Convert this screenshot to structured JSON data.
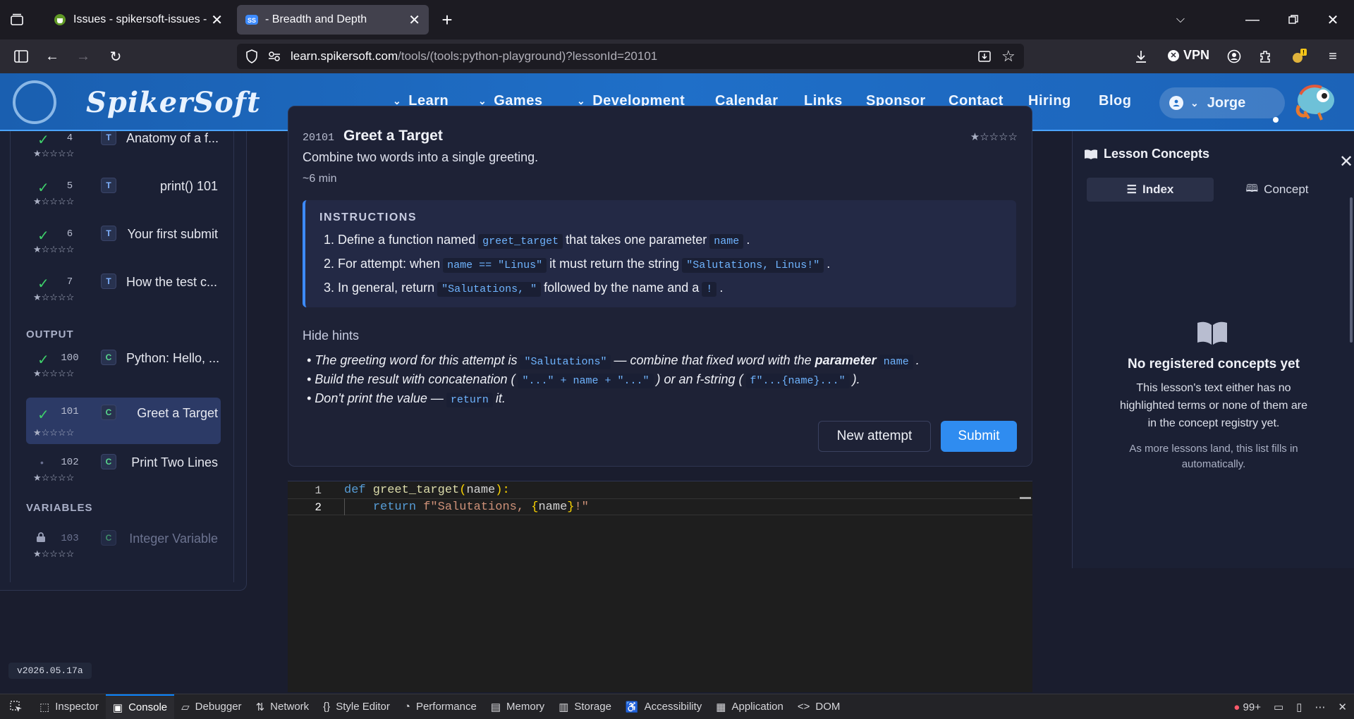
{
  "browser": {
    "tabs": [
      {
        "title": "Issues - spikersoft-issues - Gitea",
        "active": false
      },
      {
        "title": "- Breadth and Depth",
        "active": true
      }
    ],
    "url_domain": "learn.spikersoft.com",
    "url_path": "/tools/(tools:python-playground)?lessonId=20101",
    "vpn_label": "VPN"
  },
  "site": {
    "brand": "SpikerSoft",
    "nav": [
      {
        "label": "Learn",
        "dropdown": true
      },
      {
        "label": "Games",
        "dropdown": true
      },
      {
        "label": "Development",
        "dropdown": true
      },
      {
        "label": "Calendar",
        "dropdown": false
      },
      {
        "label": "Links",
        "dropdown": false
      },
      {
        "label": "Sponsor",
        "dropdown": false
      },
      {
        "label": "Contact",
        "dropdown": false
      },
      {
        "label": "Hiring",
        "dropdown": false
      },
      {
        "label": "Blog",
        "dropdown": false
      }
    ],
    "user": "Jorge"
  },
  "sidebar": {
    "lessons": [
      {
        "status": "done",
        "num": "4",
        "type": "T",
        "name": "Anatomy of a f...",
        "stars": "★☆☆☆☆"
      },
      {
        "status": "done",
        "num": "5",
        "type": "T",
        "name": "print() 101",
        "stars": "★☆☆☆☆"
      },
      {
        "status": "done",
        "num": "6",
        "type": "T",
        "name": "Your first submit",
        "stars": "★☆☆☆☆"
      },
      {
        "status": "done",
        "num": "7",
        "type": "T",
        "name": "How the test c...",
        "stars": "★☆☆☆☆"
      }
    ],
    "section_output": "OUTPUT",
    "output_lessons": [
      {
        "status": "done",
        "num": "100",
        "type": "C",
        "name": "Python: Hello, ...",
        "stars": "★☆☆☆☆"
      },
      {
        "status": "done",
        "num": "101",
        "type": "C",
        "name": "Greet a Target",
        "stars": "★☆☆☆☆"
      },
      {
        "status": "open",
        "num": "102",
        "type": "C",
        "name": "Print Two Lines",
        "stars": "★☆☆☆☆"
      }
    ],
    "section_variables": "VARIABLES",
    "variable_lessons": [
      {
        "status": "locked",
        "num": "103",
        "type": "C",
        "name": "Integer Variable",
        "stars": "★☆☆☆☆"
      }
    ],
    "version": "v2026.05.17a"
  },
  "lesson": {
    "id": "20101",
    "title": "Greet a Target",
    "stars": "★☆☆☆☆",
    "description": "Combine two words into a single greeting.",
    "time": "~6 min",
    "instructions_heading": "INSTRUCTIONS",
    "steps": {
      "s1a": "1. Define a function named",
      "s1code1": "greet_target",
      "s1b": "that takes one parameter",
      "s1code2": "name",
      "s1c": ".",
      "s2a": "2. For attempt: when",
      "s2code1": "name == \"Linus\"",
      "s2b": "it must return the string",
      "s2code2": "\"Salutations, Linus!\"",
      "s2c": ".",
      "s3a": "3. In general, return",
      "s3code1": "\"Salutations, \"",
      "s3b": "followed by the name and a",
      "s3code2": "!",
      "s3c": "."
    },
    "hide_hints": "Hide hints",
    "hints": {
      "h1a": "The greeting word for this attempt is",
      "h1code1": "\"Salutations\"",
      "h1b": "— combine that fixed word with the",
      "h1bold": "parameter",
      "h1code2": "name",
      "h1c": ".",
      "h2a": "Build the result with concatenation (",
      "h2code1": "\"...\" + name + \"...\"",
      "h2b": ") or an f-string (",
      "h2code2": "f\"...{name}...\"",
      "h2c": ").",
      "h3a": "Don't print the value —",
      "h3code1": "return",
      "h3b": "it."
    },
    "new_attempt": "New attempt",
    "submit": "Submit"
  },
  "editor": {
    "line_numbers": [
      "1",
      "2"
    ],
    "line1": {
      "kw": "def",
      "fn": " greet_target",
      "open": "(",
      "arg": "name",
      "close": "):"
    },
    "line2": {
      "indent": "    ",
      "kw": "return",
      "pre": " f\"Salutations, ",
      "ob": "{",
      "var": "name",
      "cb": "}",
      "post": "!\""
    }
  },
  "concepts": {
    "heading": "Lesson Concepts",
    "tab_index": "Index",
    "tab_concept": "Concept",
    "empty_title": "No registered concepts yet",
    "empty_text": "This lesson's text either has no highlighted terms or none of them are in the concept registry yet.",
    "empty_sub": "As more lessons land, this list fills in automatically."
  },
  "devtools": {
    "tabs": [
      "Inspector",
      "Console",
      "Debugger",
      "Network",
      "Style Editor",
      "Performance",
      "Memory",
      "Storage",
      "Accessibility",
      "Application",
      "DOM"
    ],
    "active": "Console",
    "error_count": "99+"
  },
  "colors": {
    "accent": "#2f8cf0",
    "header": "#1f6fc8",
    "success": "#3ecf6a",
    "code": "#6fb4ff"
  }
}
